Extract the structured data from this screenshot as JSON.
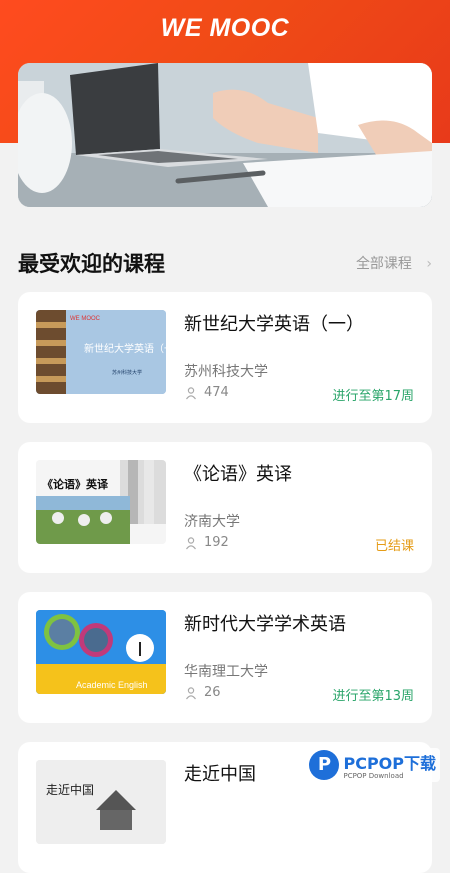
{
  "header": {
    "logo_text": "WE MOOC"
  },
  "section": {
    "title": "最受欢迎的课程",
    "all_courses_label": "全部课程"
  },
  "courses": [
    {
      "title": "新世纪大学英语（一）",
      "school": "苏州科技大学",
      "enrolled": "474",
      "status": "进行至第17周",
      "status_color": "#2aa56a",
      "thumb_caption": "新世纪大学英语（一）",
      "thumb_logo": "WE MOOC",
      "thumb_school": "苏州科技大学"
    },
    {
      "title": "《论语》英译",
      "school": "济南大学",
      "enrolled": "192",
      "status": "已结课",
      "status_color": "#e59c17",
      "thumb_caption": "《论语》英译"
    },
    {
      "title": "新时代大学学术英语",
      "school": "华南理工大学",
      "enrolled": "26",
      "status": "进行至第13周",
      "status_color": "#2aa56a",
      "thumb_caption": "Academic English"
    },
    {
      "title": "走近中国",
      "thumb_caption": "走近中国"
    }
  ],
  "watermark": {
    "text": "PCPOP下载",
    "sub": "PCPOP Download"
  }
}
